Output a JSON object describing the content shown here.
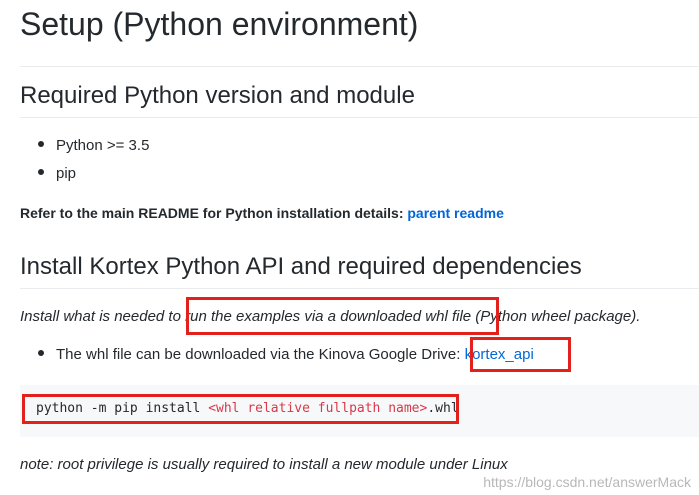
{
  "title": "Setup (Python environment)",
  "sections": [
    {
      "heading": "Required Python version and module",
      "items": [
        "Python >= 3.5",
        "pip"
      ],
      "refer_text": "Refer to the main README for Python installation details:",
      "refer_link": "parent readme"
    },
    {
      "heading": "Install Kortex Python API and required dependencies",
      "intro_before": "Install what is needed to ",
      "intro_highlight": "run the examples via a downloaded whl file",
      "intro_after": " (Python wheel package).",
      "bullet_text": "The whl file can be downloaded via the Kinova Google Drive: ",
      "bullet_link": "kortex_api",
      "code_prefix": "python -m pip install ",
      "code_tag": "<whl relative fullpath name>",
      "code_suffix": ".whl",
      "note": "note: root privilege is usually required to install a new module under Linux"
    }
  ],
  "watermark": "https://blog.csdn.net/answerMack",
  "colors": {
    "link": "#0366d6",
    "highlight_box": "#e2201c",
    "code_bg": "#f6f8fa",
    "code_tag": "#d73a49"
  }
}
